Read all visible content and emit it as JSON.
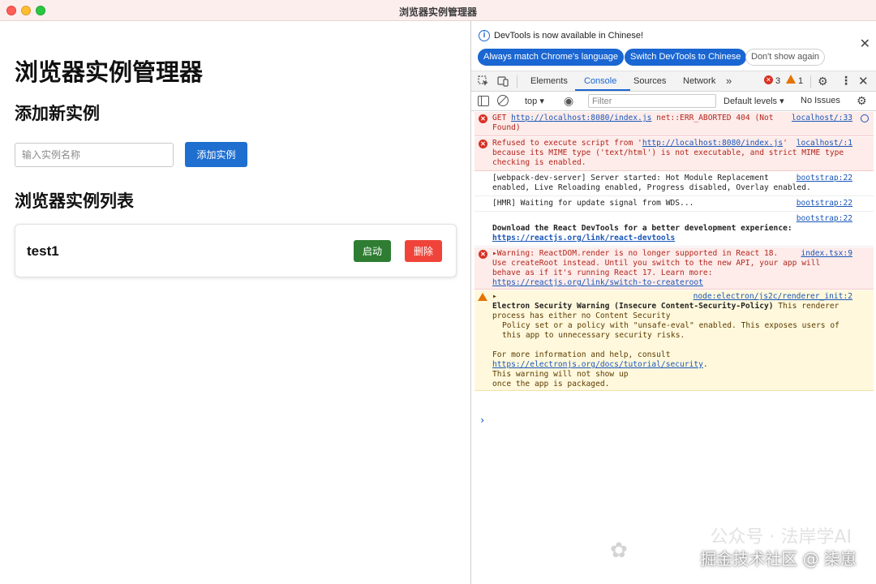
{
  "window": {
    "title": "浏览器实例管理器"
  },
  "app": {
    "heading": "浏览器实例管理器",
    "add_section_title": "添加新实例",
    "name_input_placeholder": "输入实例名称",
    "add_button": "添加实例",
    "list_section_title": "浏览器实例列表",
    "instances": [
      {
        "name": "test1",
        "start_label": "启动",
        "delete_label": "删除"
      }
    ]
  },
  "devtools": {
    "notice": {
      "text": "DevTools is now available in Chinese!",
      "buttons": [
        "Always match Chrome's language",
        "Switch DevTools to Chinese",
        "Don't show again"
      ],
      "close": "✕"
    },
    "tabs": [
      "Elements",
      "Console",
      "Sources",
      "Network"
    ],
    "active_tab": "Console",
    "more_tabs": "»",
    "error_count": "3",
    "warning_count": "1",
    "filter": {
      "context": "top",
      "placeholder": "Filter",
      "levels": "Default levels",
      "issues": "No Issues"
    },
    "messages": [
      {
        "level": "error",
        "prefix": "GET ",
        "link": "http://localhost:8080/index.js",
        "text": " net::ERR_ABORTED 404 (Not Found)",
        "source": "localhost/:33"
      },
      {
        "level": "error",
        "prefix": "Refused to execute script from '",
        "link": "http://localhost:8080/index.js",
        "text": "' because its MIME type ('text/html') is not executable, and strict MIME type checking is enabled.",
        "source": "localhost/:1"
      },
      {
        "level": "info",
        "text": "[webpack-dev-server] Server started: Hot Module Replacement enabled, Live Reloading enabled, Progress disabled, Overlay enabled.",
        "source": "bootstrap:22"
      },
      {
        "level": "info",
        "text": "[HMR] Waiting for update signal from WDS...",
        "source": "bootstrap:22"
      },
      {
        "level": "info",
        "bold": "Download the React DevTools for a better development experience: ",
        "link": "https://reactjs.org/link/react-devtools",
        "source": "bootstrap:22"
      },
      {
        "level": "error",
        "text": "Warning: ReactDOM.render is no longer supported in React 18. Use createRoot instead. Until you switch to the new API, your app will behave as if it's running React 17. Learn more: ",
        "link": "https://reactjs.org/link/switch-to-createroot",
        "source": "index.tsx:9"
      },
      {
        "level": "warning",
        "source": "node:electron/js2c/renderer_init:2",
        "bold": "Electron Security Warning (Insecure Content-Security-Policy)",
        "text": " This renderer process has either no Content Security",
        "line2": "Policy set or a policy with \"unsafe-eval\" enabled. This exposes users of",
        "line3": "this app to unnecessary security risks.",
        "line4": "For more information and help, consult",
        "link": "https://electronjs.org/docs/tutorial/security",
        "line5": "This warning will not show up",
        "line6": "once the app is packaged."
      }
    ],
    "prompt": "›"
  },
  "watermark": {
    "text": "掘金技术社区 @ 柒崽",
    "ghost_text": "公众号 · 法岸学AI"
  },
  "colors": {
    "primary_button": "#1f6fd1",
    "start_button": "#2e7d32",
    "delete_button": "#f0443a",
    "devtools_accent": "#1a66d2",
    "error_bg": "#fdecea",
    "warning_bg": "#fff8dc"
  }
}
